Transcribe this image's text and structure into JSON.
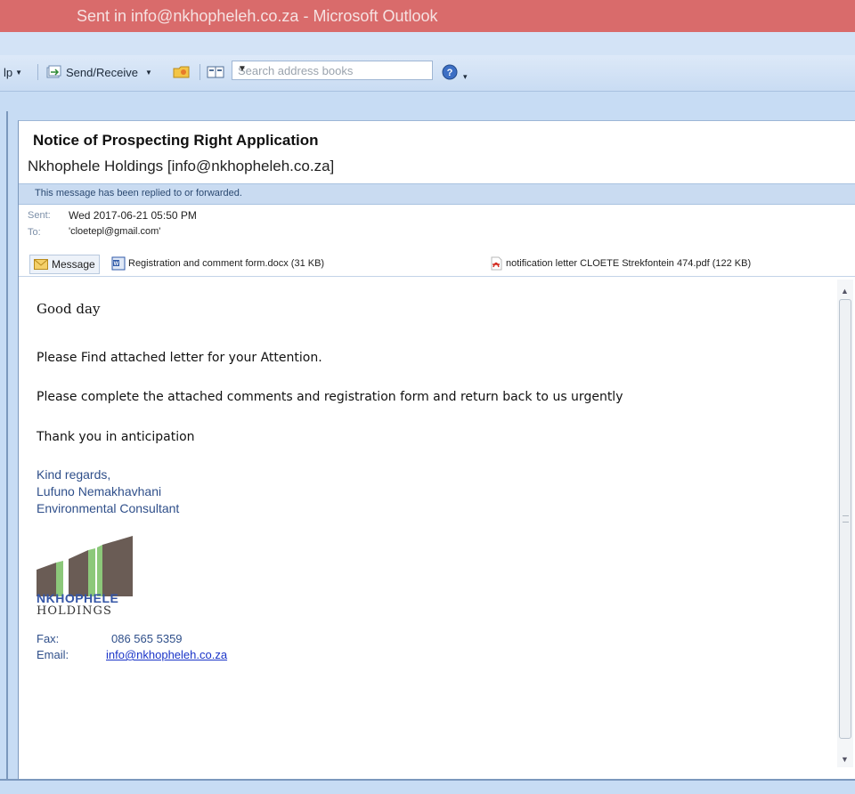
{
  "window": {
    "title": "Sent in info@nkhopheleh.co.za - Microsoft Outlook"
  },
  "toolbar": {
    "help_partial": "lp",
    "send_receive": "Send/Receive",
    "search_placeholder": "Search address books"
  },
  "message": {
    "subject": "Notice of Prospecting Right Application",
    "from": "Nkhophele Holdings [info@nkhopheleh.co.za]",
    "info_bar": "This message has been replied to or forwarded.",
    "sent_label": "Sent:",
    "sent_value": "Wed 2017-06-21 05:50 PM",
    "to_label": "To:",
    "to_value": "'cloetepl@gmail.com'"
  },
  "attachments": {
    "message_tab": "Message",
    "items": [
      {
        "name": "Registration and comment form.docx (31 KB)",
        "icon": "word-doc-icon"
      },
      {
        "name": "notification letter CLOETE Strekfontein 474.pdf (122 KB)",
        "icon": "pdf-icon"
      }
    ]
  },
  "body": {
    "greeting": "Good day",
    "line1": "Please Find attached letter for your Attention.",
    "line2": "Please complete the attached comments and registration form and return back to us urgently",
    "line3": "Thank you in anticipation",
    "sig_regards": "Kind regards,",
    "sig_name": "Lufuno Nemakhavhani",
    "sig_title": "Environmental Consultant",
    "logo_line1": "NKHOPHELE",
    "logo_line2": "HOLDINGS",
    "fax_label": "Fax:",
    "fax_value": "086 565 5359",
    "email_label": "Email:",
    "email_value": "info@nkhopheleh.co.za"
  },
  "colors": {
    "titlebar": "#d96b6b",
    "chrome": "#c7dcf4",
    "info_bar": "#c9dbf1",
    "signature": "#2f4f8a",
    "link": "#1a34c8"
  }
}
